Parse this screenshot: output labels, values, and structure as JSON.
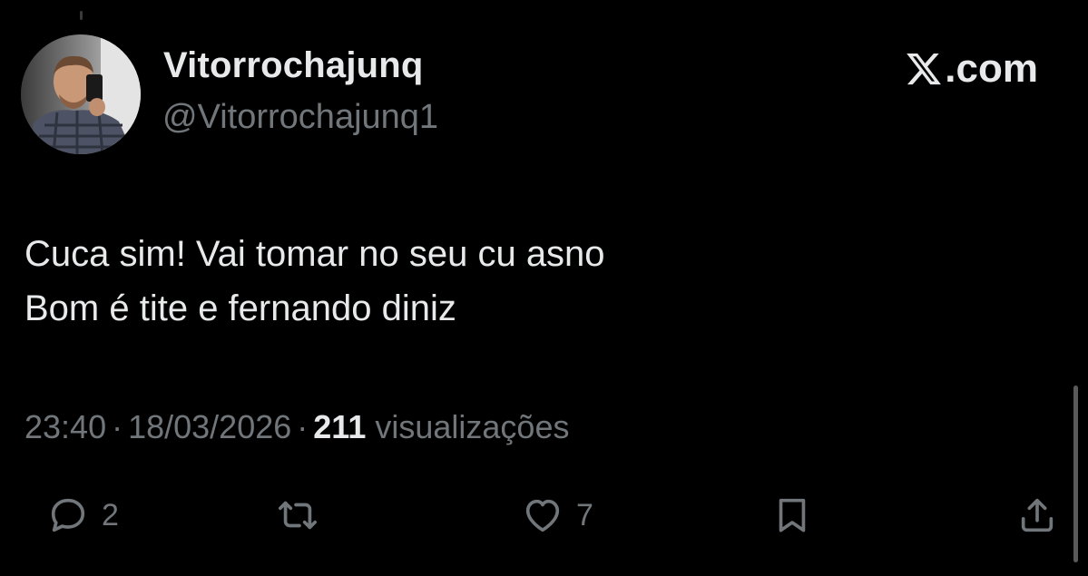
{
  "author": {
    "display_name": "Vitorrochajunq",
    "handle": "@Vitorrochajunq1",
    "avatar_icon": "profile-photo"
  },
  "brand": {
    "logo_icon": "x-logo-icon",
    "suffix": ".com"
  },
  "tweet": {
    "lines": [
      "Cuca sim! Vai tomar no seu cu asno",
      "Bom é tite e fernando diniz"
    ]
  },
  "meta": {
    "time": "23:40",
    "separator": "·",
    "date": "18/03/2026",
    "views_count": "211",
    "views_label": "visualizações"
  },
  "actions": {
    "reply_count": "2",
    "retweet_count": "",
    "like_count": "7"
  },
  "colors": {
    "background": "#000000",
    "primary_text": "#e7e9ea",
    "secondary_text": "#71767b"
  }
}
